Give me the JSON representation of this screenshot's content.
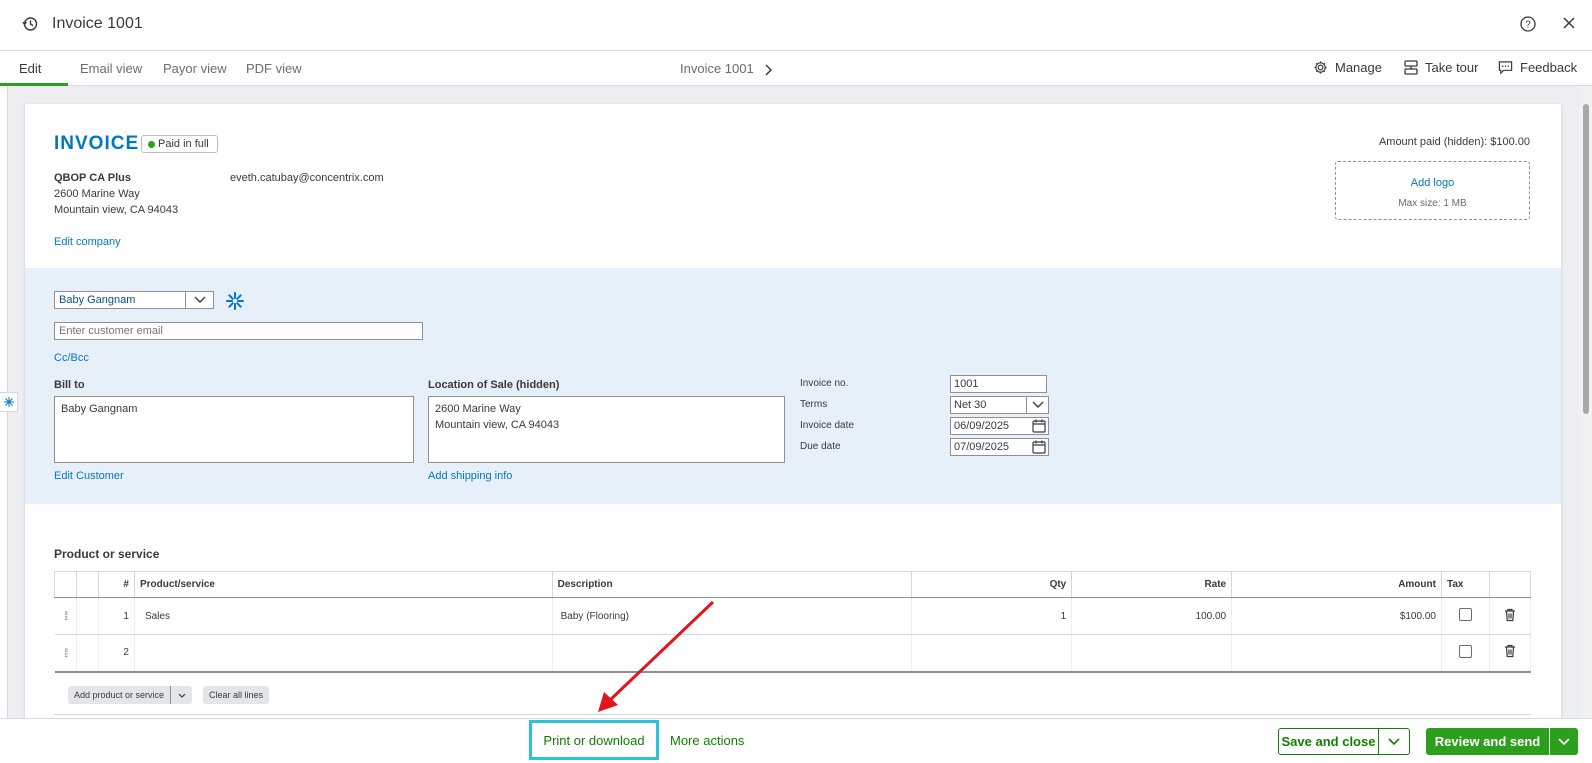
{
  "header": {
    "title": "Invoice 1001"
  },
  "tabs": [
    {
      "label": "Edit"
    },
    {
      "label": "Email view"
    },
    {
      "label": "Payor view"
    },
    {
      "label": "PDF view"
    }
  ],
  "breadcrumb": "Invoice 1001",
  "toolbar": {
    "manage": "Manage",
    "take_tour": "Take tour",
    "feedback": "Feedback"
  },
  "invoice": {
    "title": "INVOICE",
    "status": "Paid in full",
    "company_name": "QBOP CA Plus",
    "company_addr1": "2600 Marine Way",
    "company_addr2": "Mountain view, CA 94043",
    "company_email": "eveth.catubay@concentrix.com",
    "edit_company": "Edit company",
    "amount_paid": "Amount paid (hidden): $100.00",
    "add_logo": "Add logo",
    "max_size": "Max size: 1 MB"
  },
  "customer": {
    "name": "Baby Gangnam",
    "email_placeholder": "Enter customer email",
    "cc_bcc": "Cc/Bcc",
    "bill_to_label": "Bill to",
    "bill_to": "Baby Gangnam",
    "edit_customer": "Edit Customer",
    "location_label": "Location of Sale (hidden)",
    "location_line1": "2600 Marine Way",
    "location_line2": "Mountain view, CA 94043",
    "add_shipping": "Add shipping info"
  },
  "meta": {
    "invoice_no_label": "Invoice no.",
    "invoice_no": "1001",
    "terms_label": "Terms",
    "terms": "Net 30",
    "invoice_date_label": "Invoice date",
    "invoice_date": "06/09/2025",
    "due_date_label": "Due date",
    "due_date": "07/09/2025"
  },
  "lines": {
    "section_title": "Product or service",
    "headers": [
      "#",
      "Product/service",
      "Description",
      "Qty",
      "Rate",
      "Amount",
      "Tax"
    ],
    "rows": [
      {
        "num": "1",
        "product": "Sales",
        "description": "Baby (Flooring)",
        "qty": "1",
        "rate": "100.00",
        "amount": "$100.00"
      },
      {
        "num": "2",
        "product": "",
        "description": "",
        "qty": "",
        "rate": "",
        "amount": ""
      }
    ],
    "add_line": "Add product or service",
    "clear_lines": "Clear all lines"
  },
  "footer": {
    "print": "Print or download",
    "more_actions": "More actions",
    "save_close": "Save and close",
    "review_send": "Review and send"
  },
  "colors": {
    "brand_green": "#2ca01c",
    "link_blue": "#0077c5",
    "highlight": "#2ac3d8",
    "annotation_red": "#e3141b"
  }
}
